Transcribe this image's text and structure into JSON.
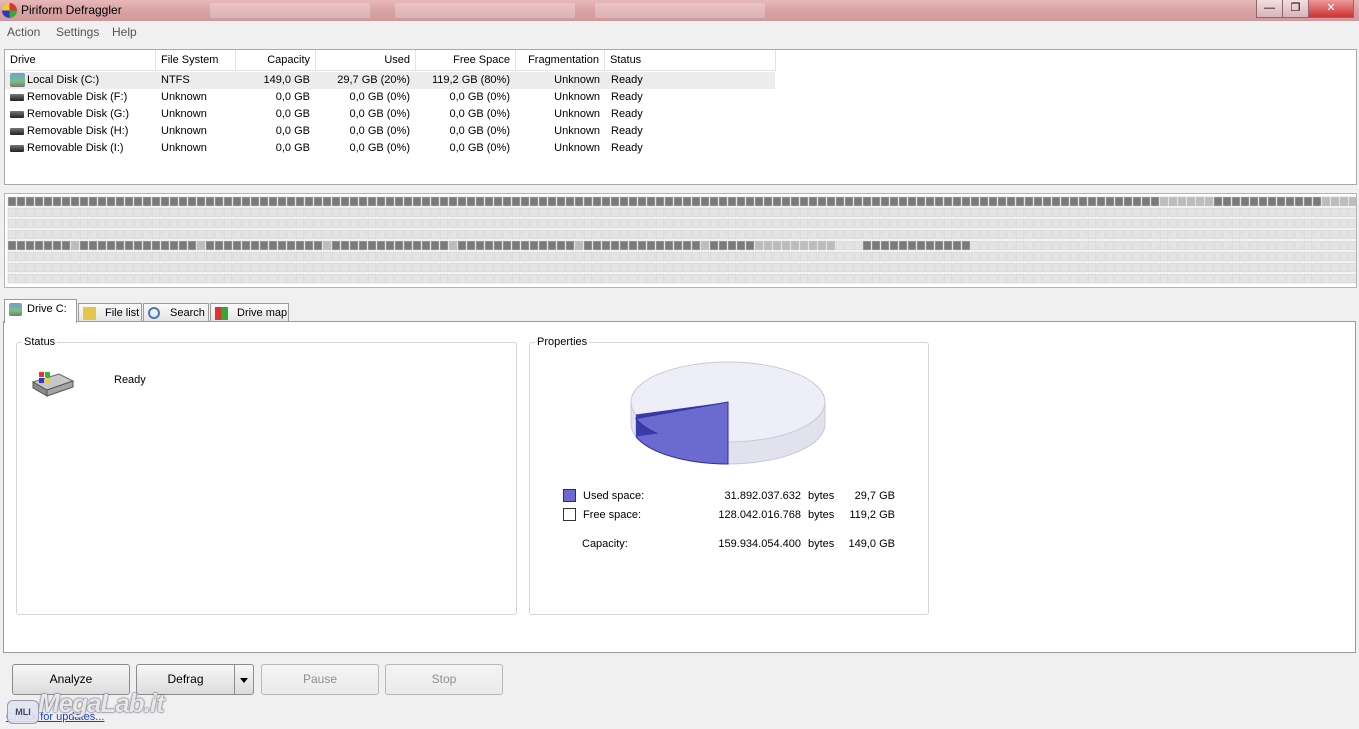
{
  "window": {
    "title": "Piriform Defraggler",
    "buttons": {
      "minimize": "—",
      "restore": "❐",
      "close": "✕"
    }
  },
  "menu": [
    "Action",
    "Settings",
    "Help"
  ],
  "drive_list": {
    "columns": [
      "Drive",
      "File System",
      "Capacity",
      "Used",
      "Free Space",
      "Fragmentation",
      "Status"
    ],
    "rows": [
      {
        "drive": "Local Disk (C:)",
        "fs": "NTFS",
        "capacity": "149,0 GB",
        "used": "29,7 GB (20%)",
        "free": "119,2 GB (80%)",
        "frag": "Unknown",
        "status": "Ready",
        "icon": "hard-drive-icon"
      },
      {
        "drive": "Removable Disk (F:)",
        "fs": "Unknown",
        "capacity": "0,0 GB",
        "used": "0,0 GB (0%)",
        "free": "0,0 GB (0%)",
        "frag": "Unknown",
        "status": "Ready",
        "icon": "removable-drive-icon"
      },
      {
        "drive": "Removable Disk (G:)",
        "fs": "Unknown",
        "capacity": "0,0 GB",
        "used": "0,0 GB (0%)",
        "free": "0,0 GB (0%)",
        "frag": "Unknown",
        "status": "Ready",
        "icon": "removable-drive-icon"
      },
      {
        "drive": "Removable Disk (H:)",
        "fs": "Unknown",
        "capacity": "0,0 GB",
        "used": "0,0 GB (0%)",
        "free": "0,0 GB (0%)",
        "frag": "Unknown",
        "status": "Ready",
        "icon": "removable-drive-icon"
      },
      {
        "drive": "Removable Disk (I:)",
        "fs": "Unknown",
        "capacity": "0,0 GB",
        "used": "0,0 GB (0%)",
        "free": "0,0 GB (0%)",
        "frag": "Unknown",
        "status": "Ready",
        "icon": "removable-drive-icon"
      }
    ]
  },
  "block_map": {
    "colors": {
      "used": "#7a7a7a",
      "free": "#e4e4e4",
      "light": "#bdbdbd"
    }
  },
  "tabs": [
    {
      "label": "Drive C:",
      "icon": "drive-icon"
    },
    {
      "label": "File list",
      "icon": "folder-icon"
    },
    {
      "label": "Search",
      "icon": "magnifier-icon"
    },
    {
      "label": "Drive map",
      "icon": "drive-map-icon"
    }
  ],
  "status_panel": {
    "title": "Status",
    "text": "Ready"
  },
  "properties_panel": {
    "title": "Properties",
    "used_fraction": 0.1994,
    "colors": {
      "used": "#6a6ad0",
      "free": "#eeeef8"
    },
    "used_label": "Used space:",
    "used_bytes": "31.892.037.632",
    "used_unit": "bytes",
    "used_gb": "29,7 GB",
    "free_label": "Free space:",
    "free_bytes": "128.042.016.768",
    "free_unit": "bytes",
    "free_gb": "119,2 GB",
    "capacity_label": "Capacity:",
    "capacity_bytes": "159.934.054.400",
    "capacity_unit": "bytes",
    "capacity_gb": "149,0 GB"
  },
  "buttons": {
    "analyze": "Analyze",
    "defrag": "Defrag",
    "pause": "Pause",
    "stop": "Stop"
  },
  "footer": {
    "updates_link": "Check for updates...",
    "watermark": "MegaLab.it",
    "watermark_logo": "MLI"
  }
}
